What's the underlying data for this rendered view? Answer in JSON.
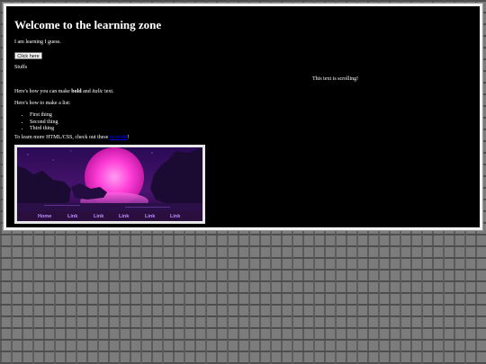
{
  "page": {
    "heading": "Welcome to the learning zone",
    "intro": "I am learning I guess.",
    "button_label": "Click here",
    "stuffs": "Stuffs",
    "scrolling_text": "This text is scrolling!",
    "format_prefix": "Here's how you can make ",
    "format_bold": "bold",
    "format_middle": " and ",
    "format_italic": "italic",
    "format_suffix": " text.",
    "list_intro": "Here's how to make a list:",
    "list_items": [
      "First thing",
      "Second thing",
      "Third thing"
    ],
    "learn_more_prefix": "To learn more HTML/CSS, check out these ",
    "learn_more_link": "tutorials",
    "learn_more_suffix": "!"
  },
  "nav": {
    "items": [
      "Home",
      "Link",
      "Link",
      "Link",
      "Link",
      "Link"
    ]
  },
  "colors": {
    "background_wall": "#7c7c7c",
    "panel": "#000000",
    "panel_border": "#f2f2f2",
    "link": "#0000ee",
    "nav_text": "#c18bff",
    "sun": "#ff3fd8"
  }
}
